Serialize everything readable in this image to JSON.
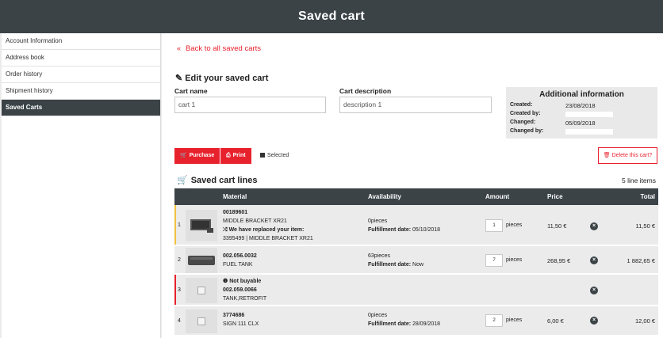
{
  "header": {
    "title": "Saved cart"
  },
  "sidebar": {
    "items": [
      {
        "label": "Account Information",
        "active": false
      },
      {
        "label": "Address book",
        "active": false
      },
      {
        "label": "Order history",
        "active": false
      },
      {
        "label": "Shipment history",
        "active": false
      },
      {
        "label": "Saved Carts",
        "active": true
      }
    ]
  },
  "back_link": "Back to all saved carts",
  "edit": {
    "title": "Edit your saved cart",
    "name_label": "Cart name",
    "name_value": "cart 1",
    "desc_label": "Cart description",
    "desc_value": "description 1"
  },
  "additional": {
    "title": "Additional information",
    "created_label": "Created:",
    "created_value": "23/08/2018",
    "created_by_label": "Created by:",
    "changed_label": "Changed:",
    "changed_value": "05/09/2018",
    "changed_by_label": "Changed by:"
  },
  "actions": {
    "purchase": "Purchase",
    "print": "Print",
    "selected": "Selected",
    "delete": "Delete this cart?"
  },
  "lines": {
    "title": "Saved cart lines",
    "count": "5 line items",
    "headers": {
      "material": "Material",
      "availability": "Availability",
      "amount": "Amount",
      "price": "Price",
      "total": "Total"
    },
    "rows": [
      {
        "num": "1",
        "code": "00189601",
        "name": "MIDDLE BRACKET XR21",
        "note": "We have replaced your item:",
        "note2": "3395499 | MIDDLE BRACKET XR21",
        "avail": "0pieces",
        "fulfill_label": "Fulfillment date:",
        "fulfill": "05/10/2018",
        "qty": "1",
        "unit": "pieces",
        "price": "11,50 €",
        "total": "11,50 €",
        "bar_color": "#f0c040"
      },
      {
        "num": "2",
        "code": "002.056.0032",
        "name": "FUEL TANK",
        "avail": "63pieces",
        "fulfill_label": "Fulfillment date:",
        "fulfill": "Now",
        "qty": "7",
        "unit": "pieces",
        "price": "268,95 €",
        "total": "1 882,65 €",
        "bar_color": "#ebebeb"
      },
      {
        "num": "3",
        "status": "Not buyable",
        "code": "002.059.0066",
        "name": "TANK,RETROFIT",
        "bar_color": "#e8222d"
      },
      {
        "num": "4",
        "code": "3774686",
        "name": "SIGN 111 CLX",
        "avail": "0pieces",
        "fulfill_label": "Fulfillment date:",
        "fulfill": "28/09/2018",
        "qty": "2",
        "unit": "pieces",
        "price": "6,00 €",
        "total": "12,00 €",
        "bar_color": "#ebebeb"
      }
    ]
  },
  "colors": {
    "accent": "#e8222d",
    "dark": "#3b4347"
  }
}
